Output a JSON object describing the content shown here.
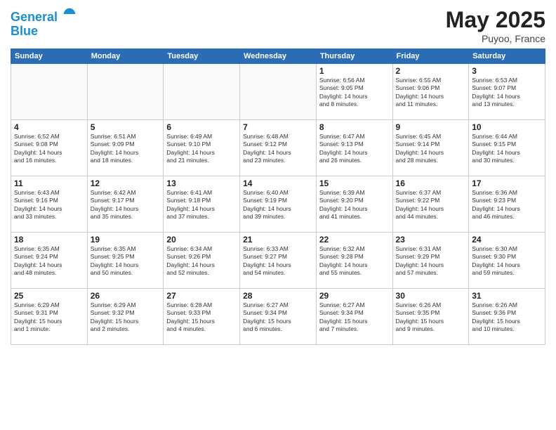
{
  "header": {
    "logo_line1": "General",
    "logo_line2": "Blue",
    "month": "May 2025",
    "location": "Puyoo, France"
  },
  "days_of_week": [
    "Sunday",
    "Monday",
    "Tuesday",
    "Wednesday",
    "Thursday",
    "Friday",
    "Saturday"
  ],
  "weeks": [
    [
      {
        "day": "",
        "info": ""
      },
      {
        "day": "",
        "info": ""
      },
      {
        "day": "",
        "info": ""
      },
      {
        "day": "",
        "info": ""
      },
      {
        "day": "1",
        "info": "Sunrise: 6:56 AM\nSunset: 9:05 PM\nDaylight: 14 hours\nand 8 minutes."
      },
      {
        "day": "2",
        "info": "Sunrise: 6:55 AM\nSunset: 9:06 PM\nDaylight: 14 hours\nand 11 minutes."
      },
      {
        "day": "3",
        "info": "Sunrise: 6:53 AM\nSunset: 9:07 PM\nDaylight: 14 hours\nand 13 minutes."
      }
    ],
    [
      {
        "day": "4",
        "info": "Sunrise: 6:52 AM\nSunset: 9:08 PM\nDaylight: 14 hours\nand 16 minutes."
      },
      {
        "day": "5",
        "info": "Sunrise: 6:51 AM\nSunset: 9:09 PM\nDaylight: 14 hours\nand 18 minutes."
      },
      {
        "day": "6",
        "info": "Sunrise: 6:49 AM\nSunset: 9:10 PM\nDaylight: 14 hours\nand 21 minutes."
      },
      {
        "day": "7",
        "info": "Sunrise: 6:48 AM\nSunset: 9:12 PM\nDaylight: 14 hours\nand 23 minutes."
      },
      {
        "day": "8",
        "info": "Sunrise: 6:47 AM\nSunset: 9:13 PM\nDaylight: 14 hours\nand 26 minutes."
      },
      {
        "day": "9",
        "info": "Sunrise: 6:45 AM\nSunset: 9:14 PM\nDaylight: 14 hours\nand 28 minutes."
      },
      {
        "day": "10",
        "info": "Sunrise: 6:44 AM\nSunset: 9:15 PM\nDaylight: 14 hours\nand 30 minutes."
      }
    ],
    [
      {
        "day": "11",
        "info": "Sunrise: 6:43 AM\nSunset: 9:16 PM\nDaylight: 14 hours\nand 33 minutes."
      },
      {
        "day": "12",
        "info": "Sunrise: 6:42 AM\nSunset: 9:17 PM\nDaylight: 14 hours\nand 35 minutes."
      },
      {
        "day": "13",
        "info": "Sunrise: 6:41 AM\nSunset: 9:18 PM\nDaylight: 14 hours\nand 37 minutes."
      },
      {
        "day": "14",
        "info": "Sunrise: 6:40 AM\nSunset: 9:19 PM\nDaylight: 14 hours\nand 39 minutes."
      },
      {
        "day": "15",
        "info": "Sunrise: 6:39 AM\nSunset: 9:20 PM\nDaylight: 14 hours\nand 41 minutes."
      },
      {
        "day": "16",
        "info": "Sunrise: 6:37 AM\nSunset: 9:22 PM\nDaylight: 14 hours\nand 44 minutes."
      },
      {
        "day": "17",
        "info": "Sunrise: 6:36 AM\nSunset: 9:23 PM\nDaylight: 14 hours\nand 46 minutes."
      }
    ],
    [
      {
        "day": "18",
        "info": "Sunrise: 6:35 AM\nSunset: 9:24 PM\nDaylight: 14 hours\nand 48 minutes."
      },
      {
        "day": "19",
        "info": "Sunrise: 6:35 AM\nSunset: 9:25 PM\nDaylight: 14 hours\nand 50 minutes."
      },
      {
        "day": "20",
        "info": "Sunrise: 6:34 AM\nSunset: 9:26 PM\nDaylight: 14 hours\nand 52 minutes."
      },
      {
        "day": "21",
        "info": "Sunrise: 6:33 AM\nSunset: 9:27 PM\nDaylight: 14 hours\nand 54 minutes."
      },
      {
        "day": "22",
        "info": "Sunrise: 6:32 AM\nSunset: 9:28 PM\nDaylight: 14 hours\nand 55 minutes."
      },
      {
        "day": "23",
        "info": "Sunrise: 6:31 AM\nSunset: 9:29 PM\nDaylight: 14 hours\nand 57 minutes."
      },
      {
        "day": "24",
        "info": "Sunrise: 6:30 AM\nSunset: 9:30 PM\nDaylight: 14 hours\nand 59 minutes."
      }
    ],
    [
      {
        "day": "25",
        "info": "Sunrise: 6:29 AM\nSunset: 9:31 PM\nDaylight: 15 hours\nand 1 minute."
      },
      {
        "day": "26",
        "info": "Sunrise: 6:29 AM\nSunset: 9:32 PM\nDaylight: 15 hours\nand 2 minutes."
      },
      {
        "day": "27",
        "info": "Sunrise: 6:28 AM\nSunset: 9:33 PM\nDaylight: 15 hours\nand 4 minutes."
      },
      {
        "day": "28",
        "info": "Sunrise: 6:27 AM\nSunset: 9:34 PM\nDaylight: 15 hours\nand 6 minutes."
      },
      {
        "day": "29",
        "info": "Sunrise: 6:27 AM\nSunset: 9:34 PM\nDaylight: 15 hours\nand 7 minutes."
      },
      {
        "day": "30",
        "info": "Sunrise: 6:26 AM\nSunset: 9:35 PM\nDaylight: 15 hours\nand 9 minutes."
      },
      {
        "day": "31",
        "info": "Sunrise: 6:26 AM\nSunset: 9:36 PM\nDaylight: 15 hours\nand 10 minutes."
      }
    ]
  ]
}
